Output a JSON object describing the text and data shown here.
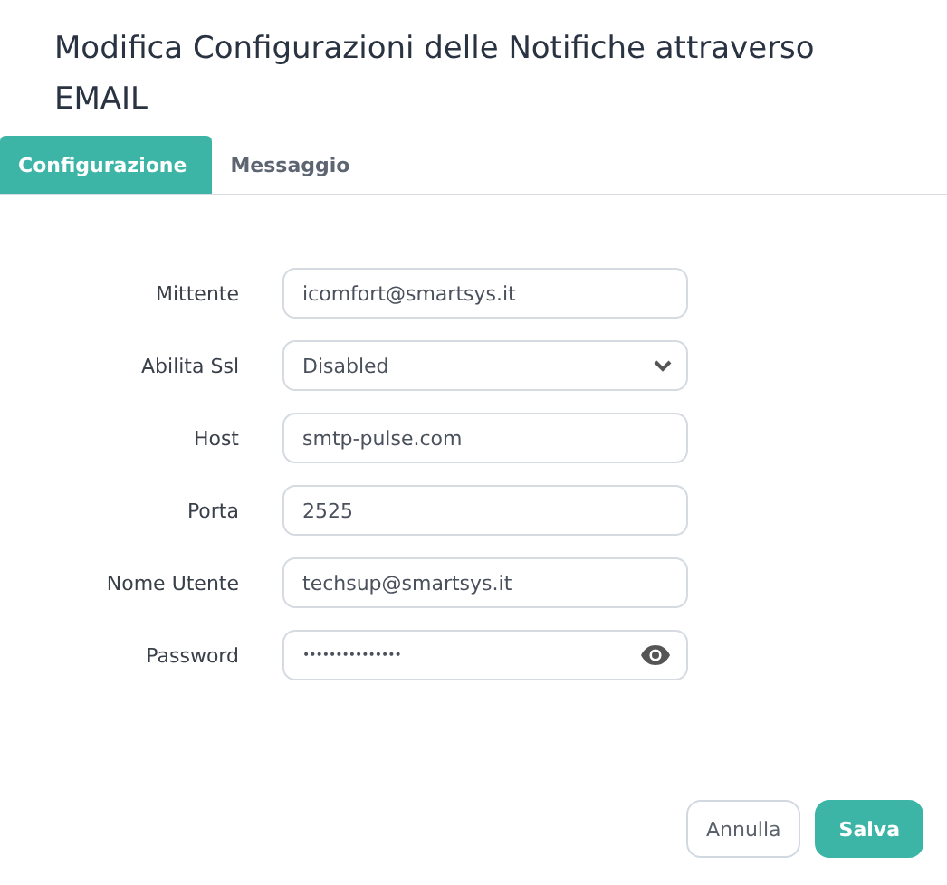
{
  "dialog": {
    "title": "Modifica Configurazioni delle Notifiche attraverso EMAIL"
  },
  "tabs": [
    {
      "label": "Configurazione",
      "selected": true
    },
    {
      "label": "Messaggio",
      "selected": false
    }
  ],
  "fields": [
    {
      "kind": "text",
      "label": "Mittente",
      "value": "icomfort@smartsys.it"
    },
    {
      "kind": "select",
      "label": "Abilita Ssl",
      "value": "Disabled"
    },
    {
      "kind": "text",
      "label": "Host",
      "value": "smtp-pulse.com"
    },
    {
      "kind": "text",
      "label": "Porta",
      "value": "2525"
    },
    {
      "kind": "text",
      "label": "Nome Utente",
      "value": "techsup@smartsys.it"
    },
    {
      "kind": "password",
      "label": "Password",
      "value": "•••••••••••••••"
    }
  ],
  "buttons": [
    {
      "label": "Annulla",
      "kind": "secondary"
    },
    {
      "label": "Salva",
      "kind": "primary"
    }
  ]
}
